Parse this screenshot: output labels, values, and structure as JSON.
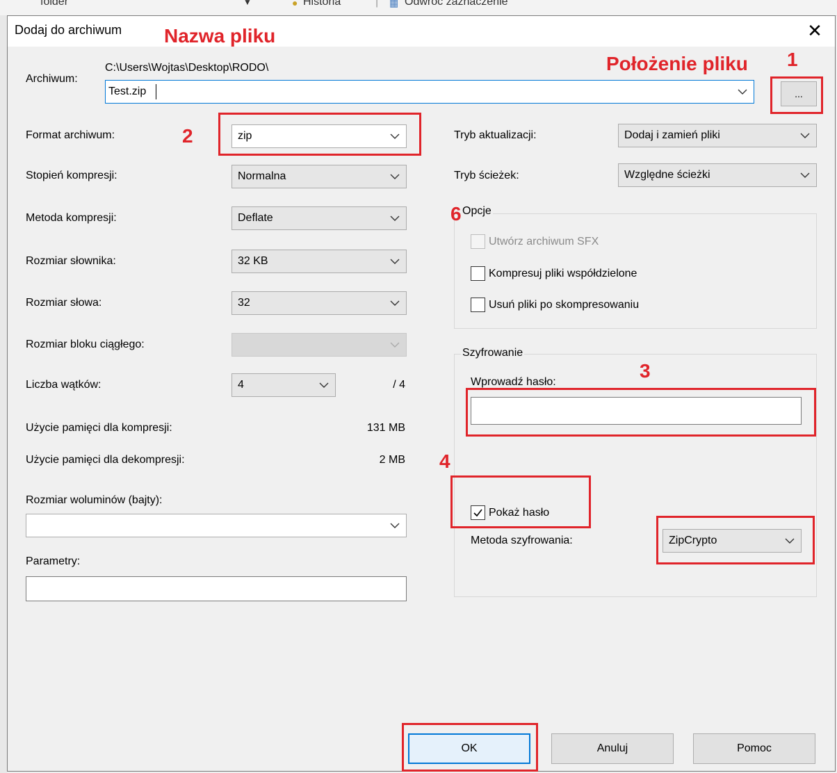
{
  "background": {
    "text_folder": "folder",
    "text_historia": "Historia",
    "text_odwroc": "Odwróć zaznaczenie"
  },
  "dialog": {
    "title": "Dodaj do archiwum",
    "close_glyph": "✕"
  },
  "archive": {
    "label": "Archiwum:",
    "path": "C:\\Users\\Wojtas\\Desktop\\RODO\\",
    "filename": "Test.zip",
    "browse_label": "..."
  },
  "left": {
    "format_label": "Format archiwum:",
    "format_value": "zip",
    "level_label": "Stopień kompresji:",
    "level_value": "Normalna",
    "method_label": "Metoda kompresji:",
    "method_value": "Deflate",
    "dict_label": "Rozmiar słownika:",
    "dict_value": "32 KB",
    "word_label": "Rozmiar słowa:",
    "word_value": "32",
    "block_label": "Rozmiar bloku ciągłego:",
    "threads_label": "Liczba wątków:",
    "threads_value": "4",
    "threads_max": "/ 4",
    "mem_comp_label": "Użycie pamięci dla kompresji:",
    "mem_comp_value": "131 MB",
    "mem_decomp_label": "Użycie pamięci dla dekompresji:",
    "mem_decomp_value": "2 MB",
    "volume_label": "Rozmiar woluminów (bajty):",
    "volume_value": "",
    "params_label": "Parametry:",
    "params_value": ""
  },
  "right": {
    "update_label": "Tryb aktualizacji:",
    "update_value": "Dodaj i zamień pliki",
    "path_mode_label": "Tryb ścieżek:",
    "path_mode_value": "Względne ścieżki",
    "options_legend": "Opcje",
    "opt_sfx": "Utwórz archiwum SFX",
    "opt_shared": "Kompresuj pliki współdzielone",
    "opt_delete": "Usuń pliki po skompresowaniu",
    "enc_legend": "Szyfrowanie",
    "password_label": "Wprowadź hasło:",
    "password_value": "",
    "show_password": "Pokaż hasło",
    "enc_method_label": "Metoda szyfrowania:",
    "enc_method_value": "ZipCrypto"
  },
  "buttons": {
    "ok": "OK",
    "cancel": "Anuluj",
    "help": "Pomoc"
  },
  "annotations": {
    "file_name": "Nazwa pliku",
    "file_location": "Położenie pliku",
    "n1": "1",
    "n2": "2",
    "n3": "3",
    "n4": "4",
    "n6": "6"
  },
  "colors": {
    "annotation_red": "#e0242a",
    "focus_blue": "#0078d7"
  }
}
